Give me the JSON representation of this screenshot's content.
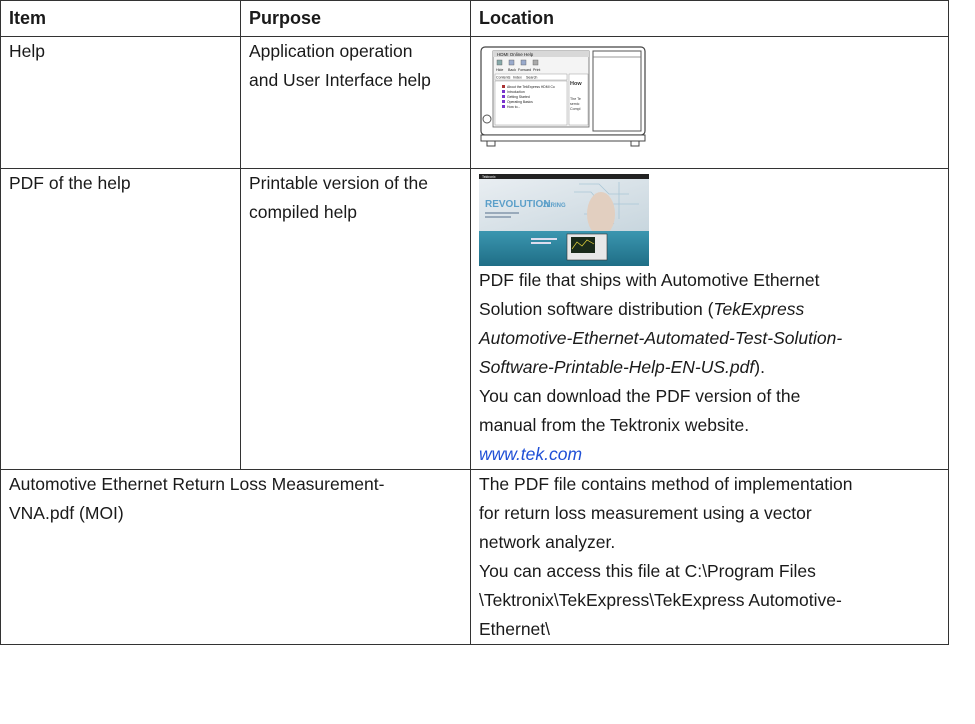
{
  "table": {
    "headers": {
      "item": "Item",
      "purpose": "Purpose",
      "location": "Location"
    },
    "rows": [
      {
        "item": "Help",
        "purpose_lines": [
          "Application operation",
          "and User Interface help"
        ],
        "screenshot": {
          "title": "HDMI Online Help",
          "toolbar": [
            "Hide",
            "Back",
            "Forward",
            "Print"
          ],
          "tabs": [
            "Contents",
            "Index",
            "Search"
          ],
          "tree": [
            "About the TekExpress HDMI Co",
            "Introduction",
            "Getting Started",
            "Operating Basics",
            "How to..."
          ],
          "pane_heading": "How",
          "pane_lines": [
            "The Te",
            "semic",
            "Compl"
          ]
        }
      },
      {
        "item": "PDF of the help",
        "purpose_lines": [
          "Printable version of the",
          "compiled help"
        ],
        "web_image": {
          "brand": "Tektronix",
          "headline_a": "REVOLUTION",
          "headline_b": "ZERING"
        },
        "location": {
          "l1": "PDF file that ships with Automotive Ethernet",
          "l2a": "Solution software distribution (",
          "l2b": "TekExpress",
          "l3": "Automotive-Ethernet-Automated-Test-Solution-",
          "l4a": "Software-Printable-Help-EN-US.pdf",
          "l4b": ").",
          "l5": "You can download the PDF version of the",
          "l6": "manual from the Tektronix website.",
          "link": "www.tek.com"
        }
      },
      {
        "item_lines": [
          "Automotive Ethernet Return Loss Measurement-",
          "VNA.pdf (MOI)"
        ],
        "location_lines": [
          "The PDF file contains method of implementation",
          "for return loss measurement using a vector",
          "network analyzer.",
          "You can access this file at C:\\Program Files",
          "\\Tektronix\\TekExpress\\TekExpress Automotive-",
          "Ethernet\\"
        ]
      }
    ]
  }
}
